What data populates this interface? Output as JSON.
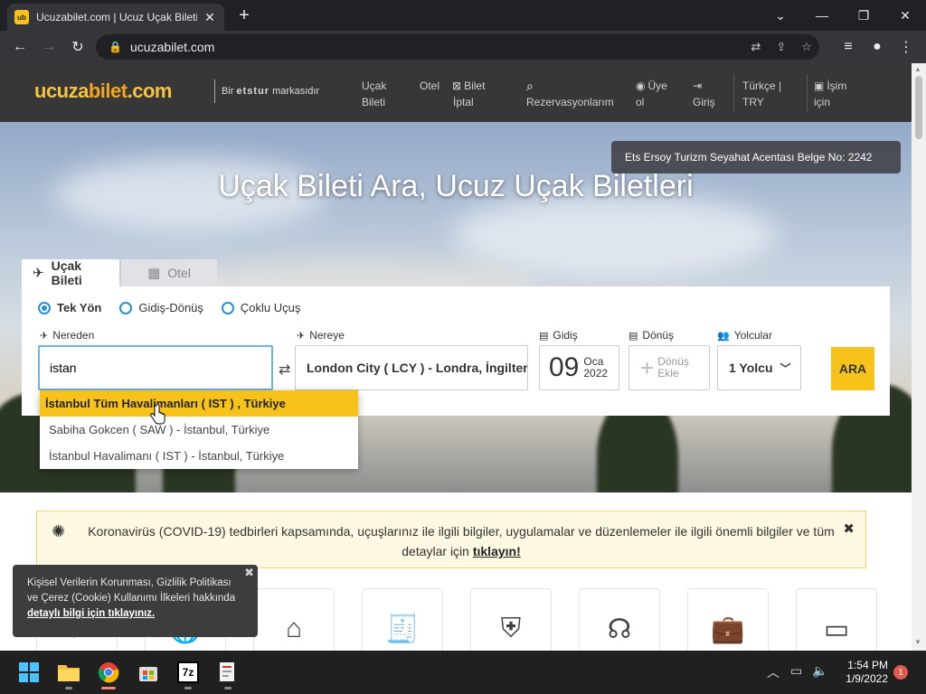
{
  "browser": {
    "tab_title": "Ucuzabilet.com | Ucuz Uçak Bileti",
    "favicon_text": "ub",
    "url": "ucuzabilet.com"
  },
  "site": {
    "logo_part1": "ucuza",
    "logo_part2": "bilet",
    "logo_part3": ".com",
    "brand_prefix": "Bir",
    "brand_name": "etstur",
    "brand_suffix": "markasıdır",
    "nav": {
      "flight_1": "Uçak",
      "flight_2": "Bileti",
      "hotel": "Otel",
      "cancel_1": "Bilet",
      "cancel_2": "İptal",
      "reservations": "Rezervasyonlarım",
      "member_1": "Üye",
      "member_2": "ol",
      "login": "Giriş",
      "lang_1": "Türkçe |",
      "lang_2": "TRY",
      "business_1": "İşim",
      "business_2": "için"
    }
  },
  "hero": {
    "cert": "Ets Ersoy Turizm Seyahat Acentası Belge No: 2242",
    "title": "Uçak Bileti Ara, Ucuz Uçak Biletleri"
  },
  "search": {
    "tab_flight": "Uçak Bileti",
    "tab_hotel": "Otel",
    "radio_oneway": "Tek Yön",
    "radio_round": "Gidiş-Dönüş",
    "radio_multi": "Çoklu Uçuş",
    "label_from": "Nereden",
    "label_to": "Nereye",
    "label_dep": "Gidiş",
    "label_ret": "Dönüş",
    "label_pax": "Yolcular",
    "from_value": "istan",
    "to_value": "London City ( LCY ) - Londra, İngiltere",
    "dep_day": "09",
    "dep_month": "Oca",
    "dep_year": "2022",
    "ret_1": "Dönüş",
    "ret_2": "Ekle",
    "pax_value": "1 Yolcu",
    "search_button": "ARA"
  },
  "suggestions": [
    "İstanbul Tüm Havalimanları ( IST ) , Türkiye",
    "Sabiha Gokcen ( SAW ) - İstanbul, Türkiye",
    "İstanbul Havalimanı ( IST ) - İstanbul, Türkiye"
  ],
  "covid": {
    "text": "Koronavirüs (COVID-19) tedbirleri kapsamında, uçuşlarınız ile ilgili bilgiler, uygulamalar ve düzenlemeler ile ilgili önemli bilgiler ve tüm detaylar için",
    "link": "tıklayın!"
  },
  "cookie": {
    "text": "Kişisel Verilerin Korunması, Gizlilik Politikası ve Çerez (Cookie) Kullanımı İlkeleri hakkında",
    "link": "detaylı bilgi için tıklayınız."
  },
  "taskbar": {
    "time": "1:54 PM",
    "date": "1/9/2022",
    "notifications": "1",
    "sevenzip": "7z"
  },
  "colors": {
    "accent": "#f7c21a",
    "header_bg": "#373737",
    "radio": "#2a8fd6"
  }
}
